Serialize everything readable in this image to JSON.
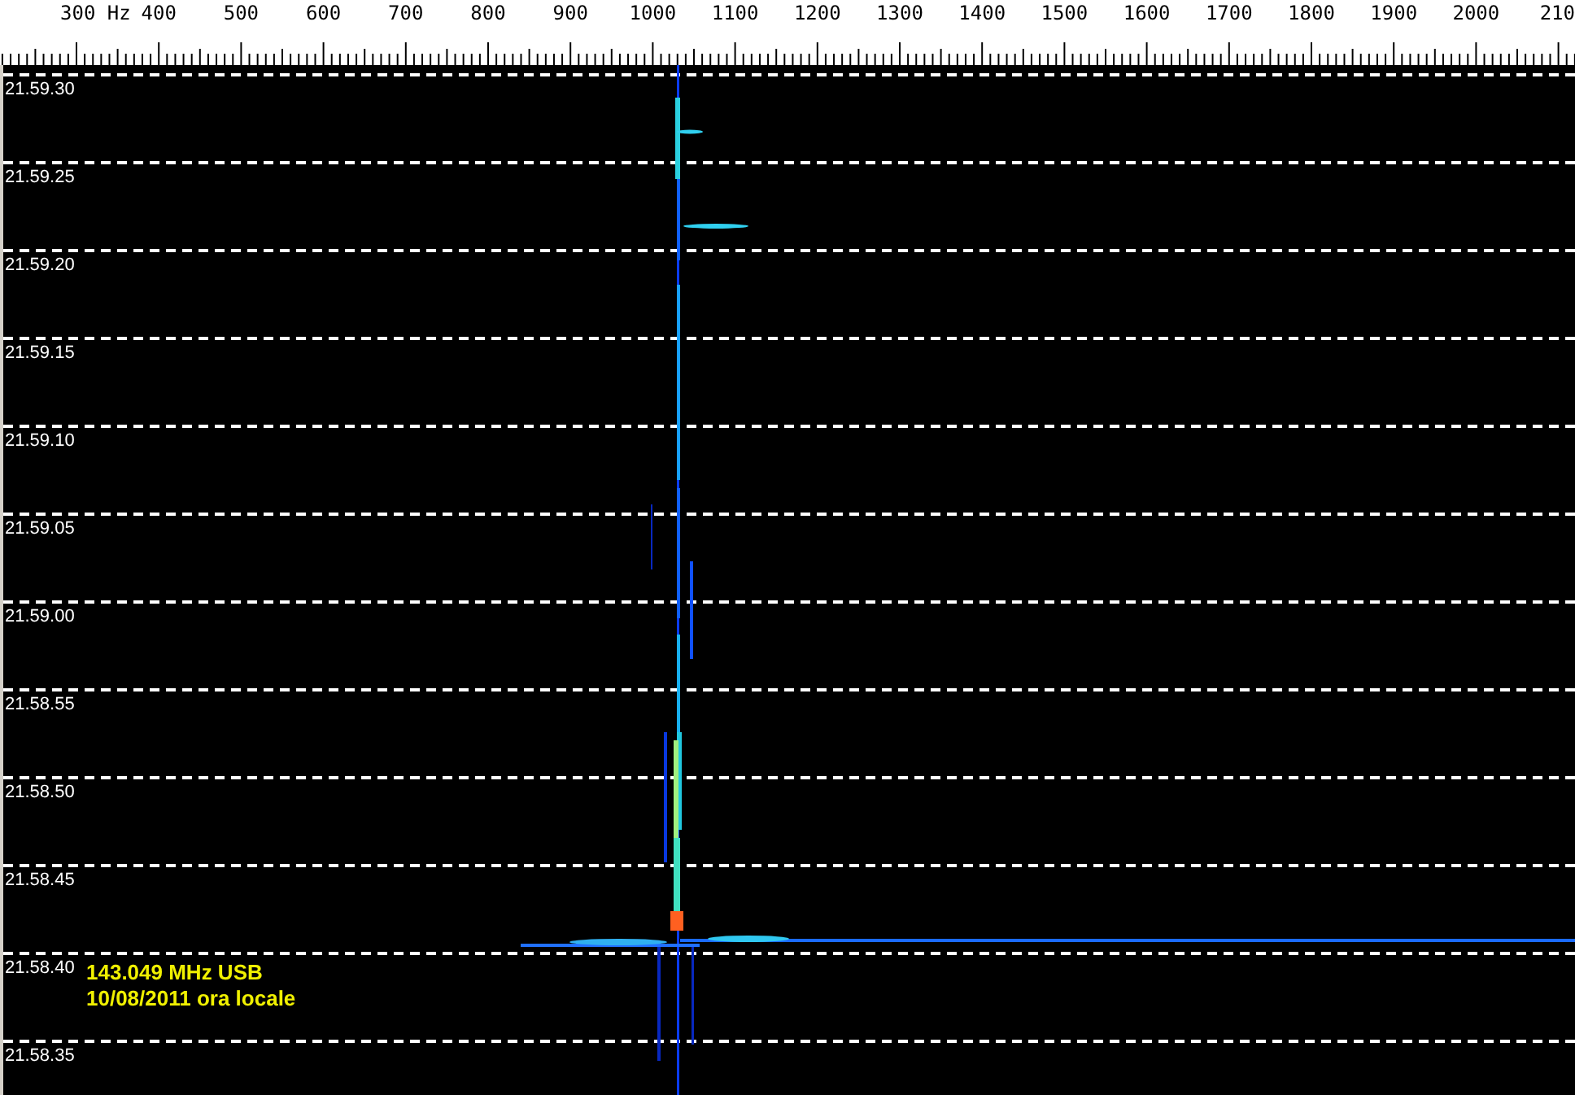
{
  "frequency_scale": {
    "labels": [
      "300 Hz",
      "400",
      "500",
      "600",
      "700",
      "800",
      "900",
      "1000",
      "1100",
      "1200",
      "1300",
      "1400",
      "1500",
      "1600",
      "1700",
      "1800",
      "1900",
      "2000",
      "210"
    ]
  },
  "time_labels": [
    "21.59.30",
    "21.59.25",
    "21.59.20",
    "21.59.15",
    "21.59.10",
    "21.59.05",
    "21.59.00",
    "21.58.55",
    "21.58.50",
    "21.58.45",
    "21.58.40",
    "21.58.35"
  ],
  "overlay": {
    "lines": [
      "143.049 MHz USB",
      "10/08/2011 ora locale"
    ]
  }
}
